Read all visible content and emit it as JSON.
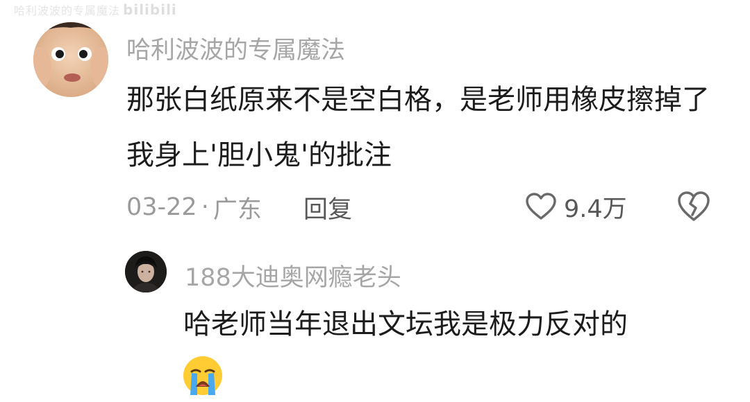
{
  "watermark": {
    "text": "哈利波波的专属魔法",
    "logo": "bilibili"
  },
  "comment": {
    "username": "哈利波波的专属魔法",
    "text": "那张白纸原来不是空白格，是老师用橡皮擦掉了 我身上'胆小鬼'的批注",
    "date": "03-22",
    "separator": "·",
    "location": "广东",
    "reply_label": "回复",
    "like_count": "9.4万",
    "like_icon": "heart-outline-icon",
    "dislike_icon": "broken-heart-icon"
  },
  "reply": {
    "username": "188大迪奥网瘾老头",
    "text": "哈老师当年退出文坛我是极力反对的",
    "emoji": "loudly-crying-face-emoji"
  },
  "colors": {
    "username": "#a6a6a6",
    "body_text": "#1c1c1c",
    "meta_text": "#9a9a9a",
    "action_text": "#585858",
    "background": "#ffffff"
  }
}
